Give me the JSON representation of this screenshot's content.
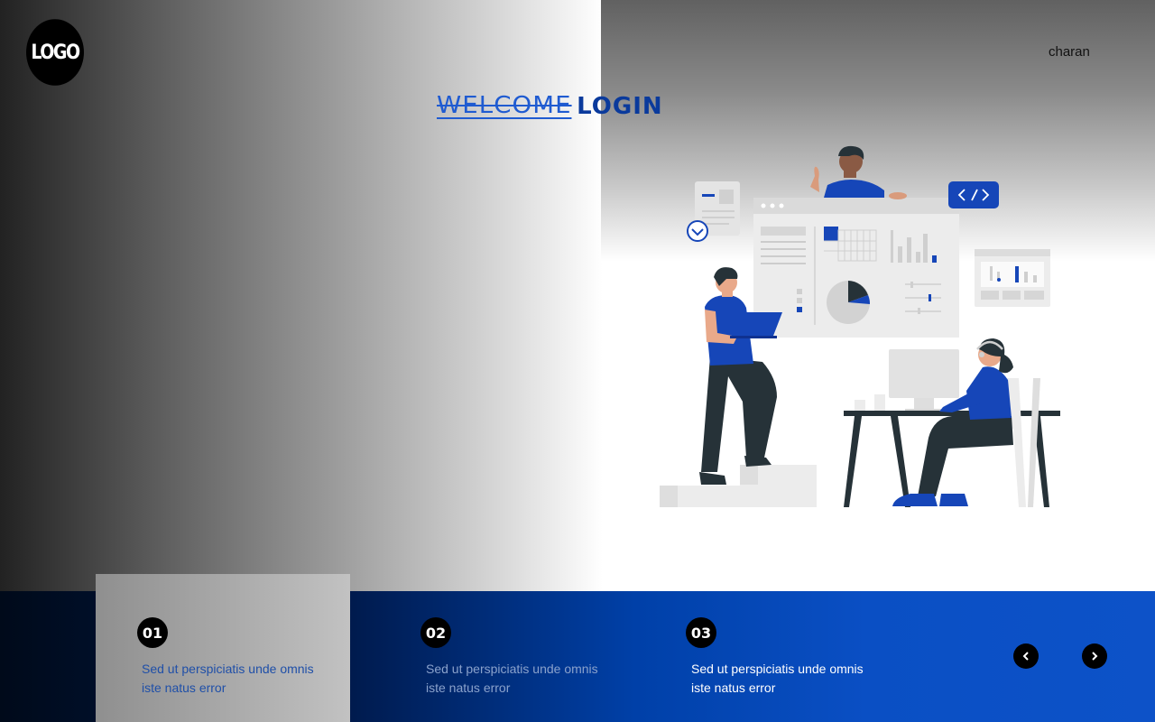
{
  "header": {
    "logo_text": "LOGO",
    "username": "charan",
    "title_part1": "WELCOME",
    "title_part2": "LOGIN"
  },
  "steps": [
    {
      "number": "01",
      "text": "Sed ut perspiciatis unde omnis iste natus error"
    },
    {
      "number": "02",
      "text": "Sed ut perspiciatis unde omnis iste natus error"
    },
    {
      "number": "03",
      "text": "Sed ut perspiciatis unde omnis iste natus error"
    }
  ],
  "carousel": {
    "prev_icon": "chevron-left-icon",
    "next_icon": "chevron-right-icon"
  },
  "colors": {
    "brand_blue": "#0d52c8",
    "title_blue": "#0a3a9c",
    "dark": "#000000"
  }
}
